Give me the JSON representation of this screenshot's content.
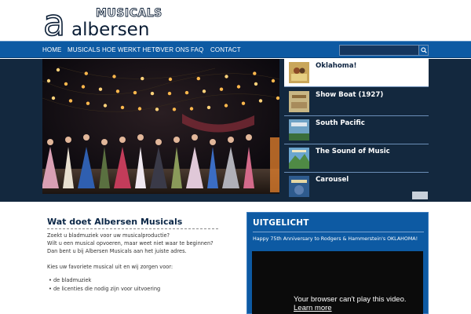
{
  "logo": {
    "top_word": "MUSICALS",
    "bottom_word": "albersen",
    "initial": "a"
  },
  "nav": {
    "items": [
      {
        "label": "HOME"
      },
      {
        "label": "MUSICALS"
      },
      {
        "label": "HOE WERKT HET?"
      },
      {
        "label": "OVER ONS"
      },
      {
        "label": "FAQ"
      },
      {
        "label": "CONTACT"
      }
    ],
    "search_placeholder": ""
  },
  "slider": {
    "items": [
      {
        "title": "Oklahoma!",
        "active": true,
        "thumb_color": "#c9a65a"
      },
      {
        "title": "Show Boat (1927)",
        "active": false,
        "thumb_color": "#c8b684"
      },
      {
        "title": "South Pacific",
        "active": false,
        "thumb_color": "#6ea1c4"
      },
      {
        "title": "The Sound of Music",
        "active": false,
        "thumb_color": "#6ba6cf"
      },
      {
        "title": "Carousel",
        "active": false,
        "thumb_color": "#2e5b8e"
      }
    ]
  },
  "main": {
    "title": "Wat doet Albersen Musicals",
    "lines": [
      "Zoekt u bladmuziek voor uw musicalproductie?",
      "Wilt u een musical opvoeren, maar weet niet waar te beginnen?",
      "Dan bent u bij Albersen Musicals aan het juiste adres.",
      "Kies uw favoriete musical uit en wij zorgen voor:"
    ],
    "bullets": [
      "de bladmuziek",
      "de licenties die nodig zijn voor uitvoering"
    ]
  },
  "sidebar": {
    "title": "UITGELICHT",
    "text": "Happy 75th Anniversary to Rodgers & Hammerstein's OKLAHOMA!",
    "video_message": "Your browser can't play this video.",
    "video_link": "Learn more"
  },
  "colors": {
    "nav_blue": "#0d5aa3",
    "band_dark": "#13283e",
    "title_navy": "#0b2747"
  }
}
